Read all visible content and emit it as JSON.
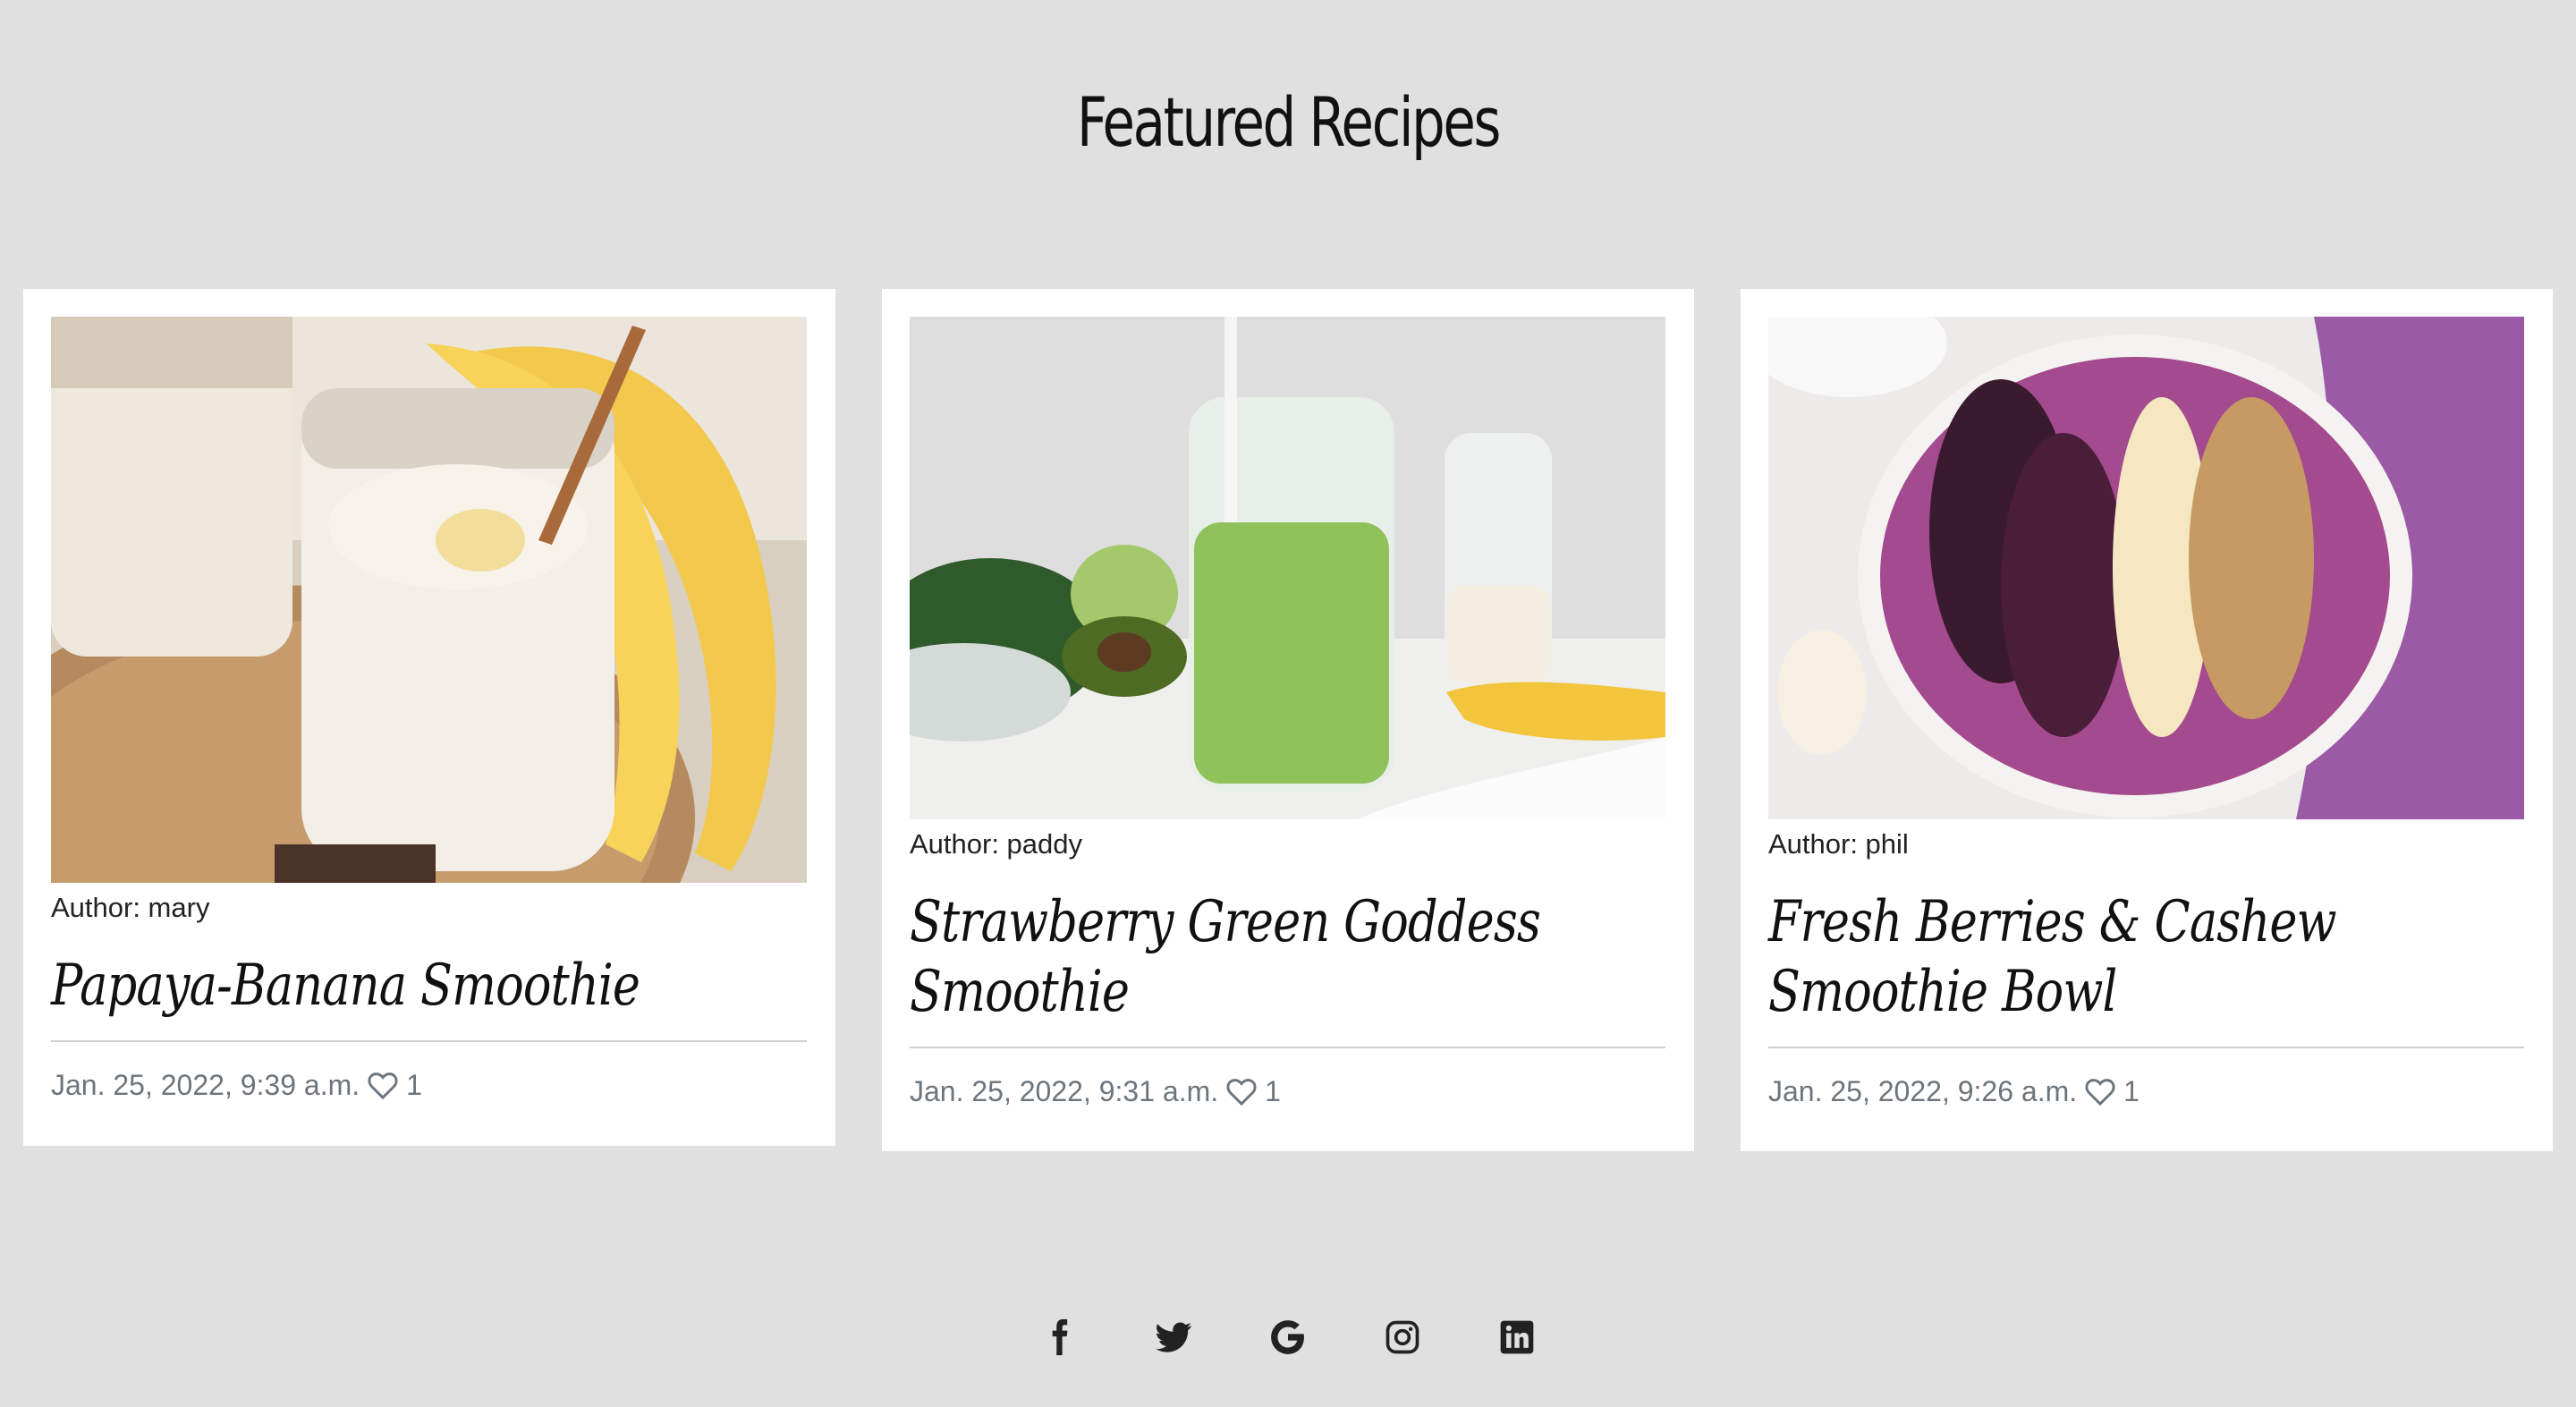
{
  "page_title": "Featured Recipes",
  "recipes": [
    {
      "author": "Author: mary",
      "title": "Papaya-Banana Smoothie",
      "date": "Jan. 25, 2022, 9:39 a.m.",
      "likes": "1",
      "image_alt": "Banana smoothie in jars with bananas"
    },
    {
      "author": "Author: paddy",
      "title": "Strawberry Green Goddess Smoothie",
      "date": "Jan. 25, 2022, 9:31 a.m.",
      "likes": "1",
      "image_alt": "Green smoothie in a jar with avocado and spinach"
    },
    {
      "author": "Author: phil",
      "title": "Fresh Berries & Cashew Smoothie Bowl",
      "date": "Jan. 25, 2022, 9:26 a.m.",
      "likes": "1",
      "image_alt": "Purple smoothie bowl with berries, banana and coconut"
    }
  ],
  "footer": {
    "social_icons": [
      "facebook-icon",
      "twitter-icon",
      "google-icon",
      "instagram-icon",
      "linkedin-icon"
    ]
  },
  "colors": {
    "background": "#e0e0e0",
    "card": "#ffffff",
    "meta_text": "#6c757d",
    "icon": "#222222"
  }
}
